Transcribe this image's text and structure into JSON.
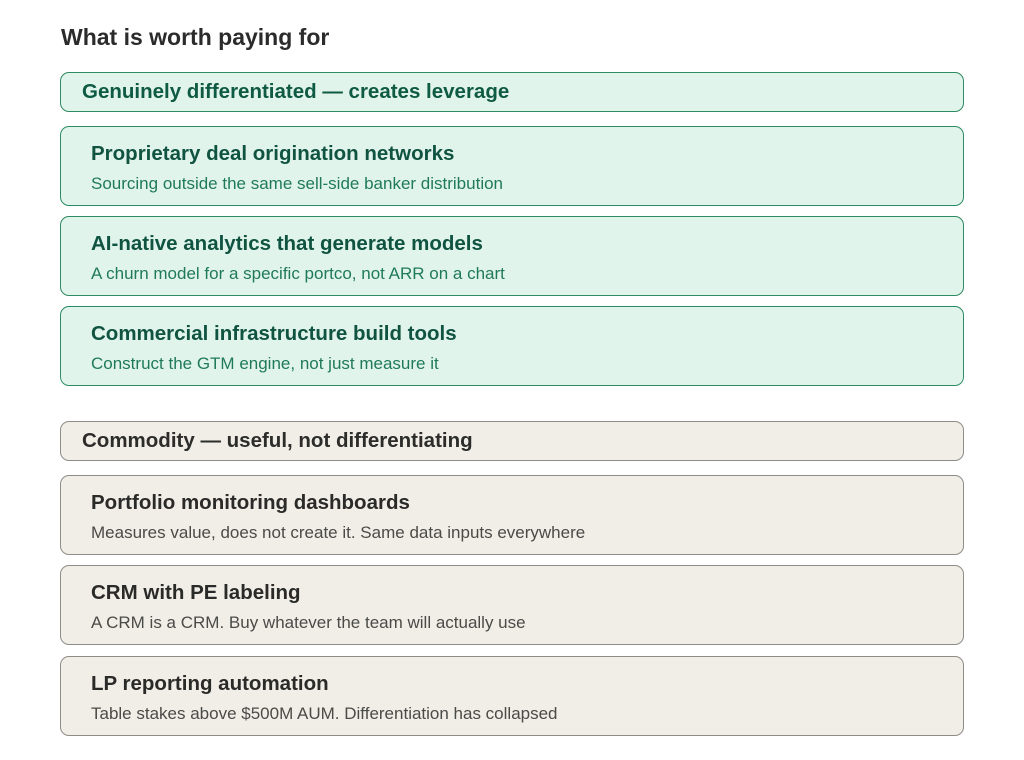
{
  "title": "What is worth paying for",
  "differentiated": {
    "header": "Genuinely differentiated — creates leverage",
    "items": [
      {
        "title": "Proprietary deal origination networks",
        "description": "Sourcing outside the same sell-side banker distribution"
      },
      {
        "title": "AI-native analytics that generate models",
        "description": "A churn model for a specific portco, not ARR on a chart"
      },
      {
        "title": "Commercial infrastructure build tools",
        "description": "Construct the GTM engine, not just measure it"
      }
    ]
  },
  "commodity": {
    "header": "Commodity — useful, not differentiating",
    "items": [
      {
        "title": "Portfolio monitoring dashboards",
        "description": "Measures value, does not create it. Same data inputs everywhere"
      },
      {
        "title": "CRM with PE labeling",
        "description": "A CRM is a CRM. Buy whatever the team will actually use"
      },
      {
        "title": "LP reporting automation",
        "description": "Table stakes above $500M AUM. Differentiation has collapsed"
      }
    ]
  },
  "colors": {
    "differentiated_fill": "#e1f4ec",
    "differentiated_border": "#2e8b63",
    "commodity_fill": "#f1eee8",
    "commodity_border": "#8e8c87"
  }
}
